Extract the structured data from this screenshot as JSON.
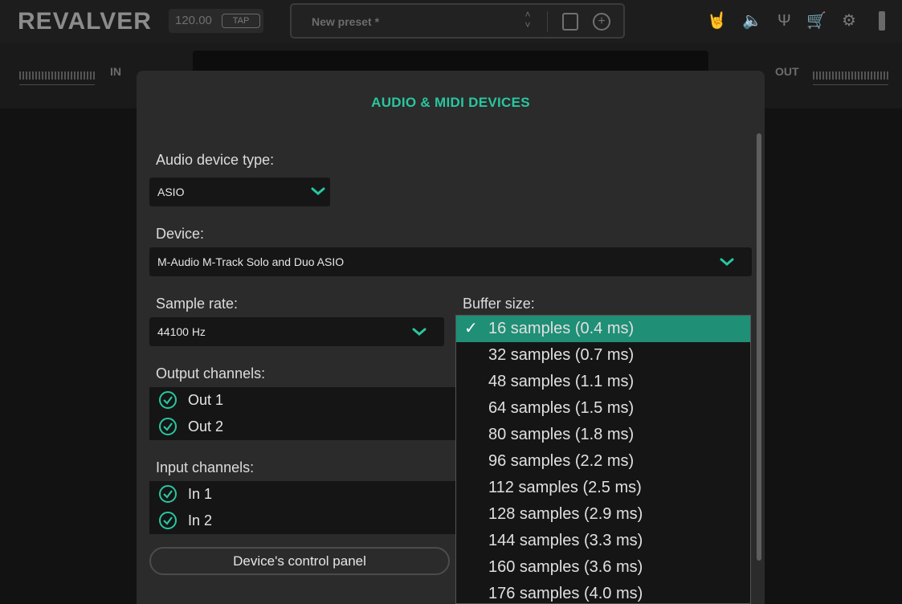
{
  "app": {
    "logo": "REVALVER",
    "tempo": "120.00",
    "tap_label": "TAP",
    "preset_name": "New preset *"
  },
  "io": {
    "in_label": "IN",
    "out_label": "OUT"
  },
  "icons": {
    "rock_hand": "rock-hand-icon",
    "speaker": "speaker-icon",
    "tuner": "tuning-fork-icon",
    "cart": "cart-icon",
    "settings": "gear-icon"
  },
  "dialog": {
    "title": "AUDIO & MIDI DEVICES",
    "audio_device_type_label": "Audio device type:",
    "audio_device_type": "ASIO",
    "device_label": "Device:",
    "device": "M-Audio M-Track Solo and Duo ASIO",
    "sample_rate_label": "Sample rate:",
    "sample_rate": "44100 Hz",
    "buffer_size_label": "Buffer size:",
    "output_channels_label": "Output channels:",
    "output_channels": [
      "Out 1",
      "Out 2"
    ],
    "input_channels_label": "Input channels:",
    "input_channels": [
      "In 1",
      "In 2"
    ],
    "control_panel_button": "Device's control panel"
  },
  "buffer_options": {
    "selected_check": "✓",
    "items": [
      "16 samples (0.4 ms)",
      "32 samples (0.7 ms)",
      "48 samples (1.1 ms)",
      "64 samples (1.5 ms)",
      "80 samples (1.8 ms)",
      "96 samples (2.2 ms)",
      "112 samples (2.5 ms)",
      "128 samples (2.9 ms)",
      "144 samples (3.3 ms)",
      "160 samples (3.6 ms)",
      "176 samples (4.0 ms)"
    ]
  },
  "colors": {
    "accent": "#29c6a0",
    "selection": "#1f8f76"
  }
}
